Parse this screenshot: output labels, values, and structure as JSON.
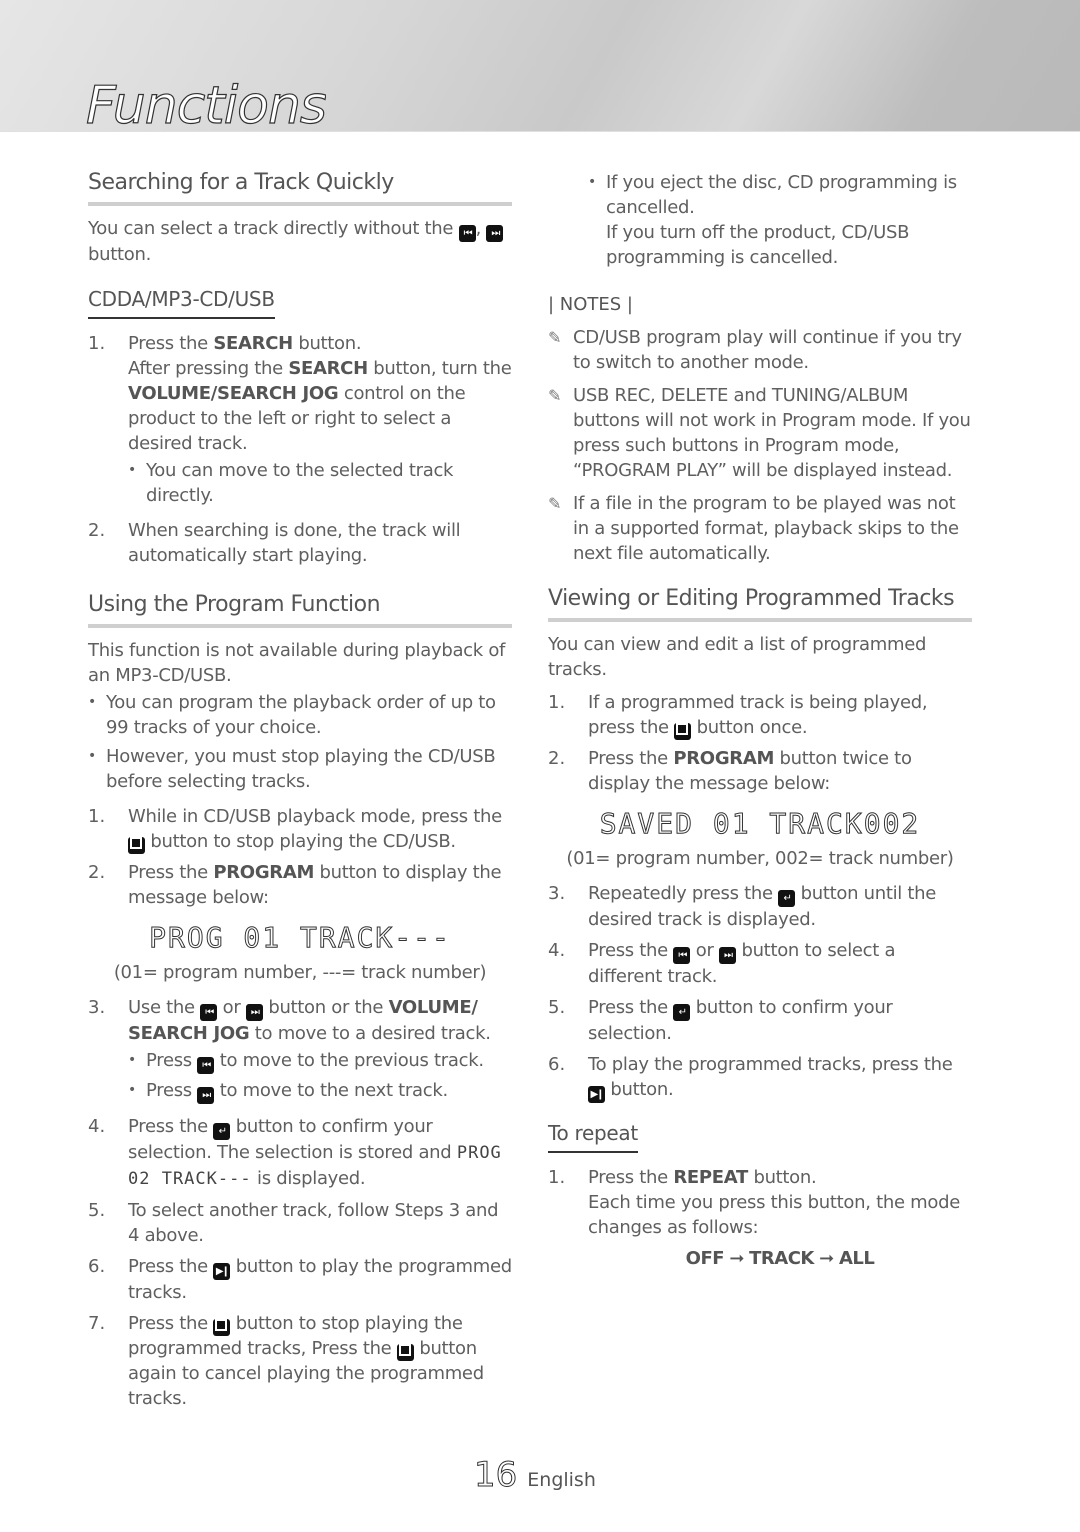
{
  "page": {
    "title": "Functions",
    "page_number": "16",
    "language": "English"
  },
  "left": {
    "search_section": {
      "heading": "Searching for a Track Quickly",
      "intro_a": "You can select a track directly without the",
      "intro_b": "button.",
      "subheading": "CDDA/MP3-CD/USB",
      "steps": [
        {
          "num": "1.",
          "a": "Press the",
          "bold_a": "SEARCH",
          "b": "button.",
          "c": "After pressing the",
          "bold_b": "SEARCH",
          "d": "button, turn the",
          "bold_c": "VOLUME/SEARCH JOG",
          "e": "control on the product to the left or right to select a desired track.",
          "bullet": "You can move to the selected track directly."
        },
        {
          "num": "2.",
          "text": "When searching is done, the track will automatically start playing."
        }
      ]
    },
    "program_section": {
      "heading": "Using the Program Function",
      "intro": "This function is not available during playback of an MP3-CD/USB.",
      "bullets": [
        "You can program the playback order of up to 99 tracks of your choice.",
        "However, you must stop playing the CD/USB before selecting tracks."
      ],
      "steps": [
        {
          "num": "1.",
          "a": "While in CD/USB playback mode, press the",
          "b": "button to stop playing the CD/USB."
        },
        {
          "num": "2.",
          "a": "Press the",
          "bold": "PROGRAM",
          "b": "button to display the message below:"
        },
        {
          "num": "3.",
          "a": "Use the",
          "or": "or",
          "b": "button or the",
          "bold": "VOLUME/ SEARCH JOG",
          "c": "to move to a desired track.",
          "bullet_prev_a": "Press",
          "bullet_prev_b": "to move to the previous track.",
          "bullet_next_a": "Press",
          "bullet_next_b": "to move to the next track."
        },
        {
          "num": "4.",
          "a": "Press the",
          "b": "button to confirm your selection. The selection is stored and",
          "lcd": "PROG 02 TRACK---",
          "c": "is displayed."
        },
        {
          "num": "5.",
          "text": "To select another track, follow Steps 3 and 4 above."
        },
        {
          "num": "6.",
          "a": "Press the",
          "b": "button to play the programmed tracks."
        },
        {
          "num": "7.",
          "a": "Press the",
          "b": "button to stop playing the programmed tracks, Press the",
          "c": "button again to cancel playing the programmed tracks."
        }
      ],
      "lcd_display": "PROG 01 TRACK---",
      "lcd_caption": "(01= program number, ---= track number)"
    }
  },
  "right": {
    "eject_bullet_a": "If you eject the disc, CD programming is cancelled.",
    "eject_bullet_b": "If you turn off the product, CD/USB programming is cancelled.",
    "notes_label": "| NOTES |",
    "notes": [
      "CD/USB program play will continue if you try to switch to another mode.",
      "USB REC, DELETE and TUNING/ALBUM buttons will not work in Program mode. If you press such buttons in Program mode, “PROGRAM PLAY” will be displayed instead.",
      "If a file in the program to be played was not in a supported format, playback skips to the next file automatically."
    ],
    "edit_section": {
      "heading": "Viewing or Editing Programmed Tracks",
      "intro": "You can view and edit a list of programmed tracks.",
      "steps": [
        {
          "num": "1.",
          "a": "If a programmed track is being played, press the",
          "b": "button once."
        },
        {
          "num": "2.",
          "a": "Press the",
          "bold": "PROGRAM",
          "b": "button twice to display the message below:"
        },
        {
          "num": "3.",
          "a": "Repeatedly press the",
          "b": "button until the desired track is displayed."
        },
        {
          "num": "4.",
          "a": "Press the",
          "or": "or",
          "b": "button to select a different track."
        },
        {
          "num": "5.",
          "a": "Press the",
          "b": "button to confirm your selection."
        },
        {
          "num": "6.",
          "a": "To play the programmed tracks, press the",
          "b": "button."
        }
      ],
      "lcd_display": "SAVED 01 TRACK002",
      "lcd_caption": "(01= program number, 002= track number)"
    },
    "repeat_section": {
      "subheading": "To repeat",
      "step_num": "1.",
      "a": "Press the",
      "bold": "REPEAT",
      "b": "button.",
      "c": "Each time you press this button, the mode changes as follows:",
      "modes": [
        "OFF",
        "TRACK",
        "ALL"
      ],
      "arrow": "➞"
    }
  },
  "icons": {
    "prev": "⏮",
    "next": "⏭",
    "play_pause": "▶❙",
    "enter": "↵",
    "pen": "✎",
    "bullet": "•"
  }
}
